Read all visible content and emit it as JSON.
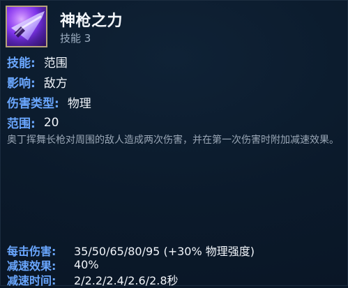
{
  "tooltip": {
    "icon_name": "spear-skill-icon",
    "title": "神枪之力",
    "subtitle": "技能 3",
    "stats": [
      {
        "key": "技能:",
        "value": "范围"
      },
      {
        "key": "影响:",
        "value": "敌方"
      },
      {
        "key": "伤害类型:",
        "value": "物理"
      },
      {
        "key": "范围:",
        "value": "20"
      }
    ],
    "description": "奥丁挥舞长枪对周围的敌人造成两次伤害，并在第一次伤害时附加减速效果。",
    "details": [
      {
        "key": "每击伤害:",
        "value": "35/50/65/80/95 (+30% 物理强度)"
      },
      {
        "key": "减速效果:",
        "value": "40%"
      },
      {
        "key": "减速时间:",
        "value": "2/2.2/2.4/2.6/2.8秒"
      }
    ],
    "colors": {
      "background": "#0b1a2b",
      "key_label": "#6aa7ff",
      "value_text": "#f1f5fa",
      "description_text": "#9aa7b6",
      "icon_border": "#b7a27a",
      "icon_glow": "#7a2ee6"
    }
  }
}
